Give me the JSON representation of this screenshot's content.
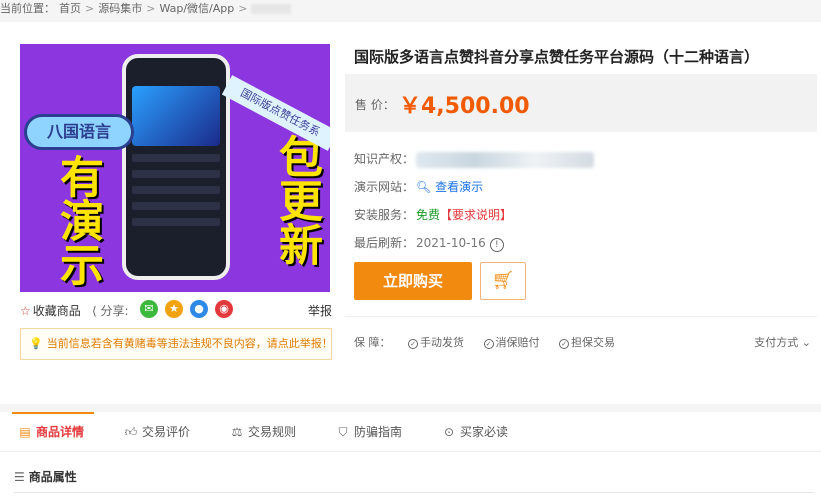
{
  "breadcrumb": {
    "label": "当前位置：",
    "items": [
      "首页",
      "源码集市",
      "Wap/微信/App"
    ],
    "sep": ">"
  },
  "product": {
    "image_text": {
      "tag": "八国语言",
      "left": "有演示",
      "right": "包更新",
      "ribbon": "国际版点赞任务系"
    },
    "title": "国际版多语言点赞抖音分享点赞任务平台源码（十二种语言）",
    "price_label": "售  价：",
    "price": "￥4,500.00",
    "rows": {
      "ip_label": "知识产权：",
      "demo_label": "演示网站：",
      "demo_link": "查看演示",
      "install_label": "安装服务：",
      "install_free": "免费",
      "install_req": "【要求说明】",
      "refresh_label": "最后刷新：",
      "refresh_date": "2021-10-16",
      "info_icon": "!"
    },
    "buy_label": "立即购买",
    "cart_icon": "cart-icon",
    "guarantee_label": "保  障：",
    "guarantees": [
      "手动发货",
      "消保赔付",
      "担保交易"
    ],
    "pay_label": "支付方式"
  },
  "actions": {
    "favorite": "收藏商品",
    "share": "分享:",
    "report": "举报"
  },
  "notice": "当前信息若含有黄赌毒等违法违规不良内容，请点此举报！",
  "tabs": [
    {
      "label": "商品详情",
      "icon": "detail-icon"
    },
    {
      "label": "交易评价",
      "icon": "thumb-icon"
    },
    {
      "label": "交易规则",
      "icon": "scale-icon"
    },
    {
      "label": "防骗指南",
      "icon": "shield-icon"
    },
    {
      "label": "买家必读",
      "icon": "read-icon"
    }
  ],
  "attributes": {
    "title": "商品属性"
  },
  "colors": {
    "accent": "#f28a0f",
    "price": "#f25a00",
    "purple": "#8c36e0"
  }
}
